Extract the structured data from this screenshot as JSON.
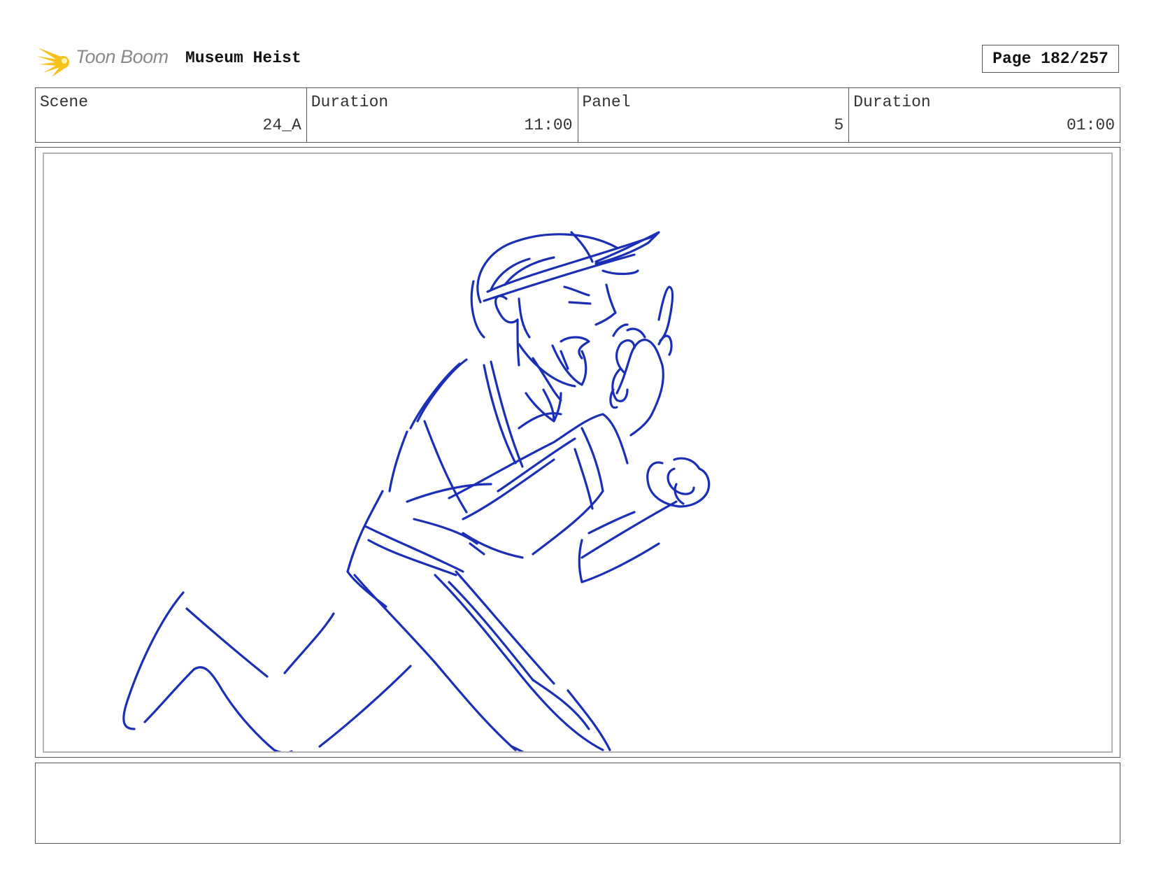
{
  "header": {
    "logo_text": "Toon Boom",
    "project_title": "Museum Heist",
    "page": "Page 182/257"
  },
  "info": {
    "scene_label": "Scene",
    "scene_value": "24_A",
    "scene_duration_label": "Duration",
    "scene_duration_value": "11:00",
    "panel_label": "Panel",
    "panel_value": "5",
    "panel_duration_label": "Duration",
    "panel_duration_value": "01:00"
  },
  "panel": {
    "sketch_color": "#1a2fb5",
    "sketch_subject": "character-running-sketch"
  },
  "notes": {
    "text": ""
  },
  "colors": {
    "logo_star": "#f6c21a",
    "logo_text": "#8a8a8a",
    "frame_border": "#555555",
    "safe_frame": "#b4b4b4"
  }
}
